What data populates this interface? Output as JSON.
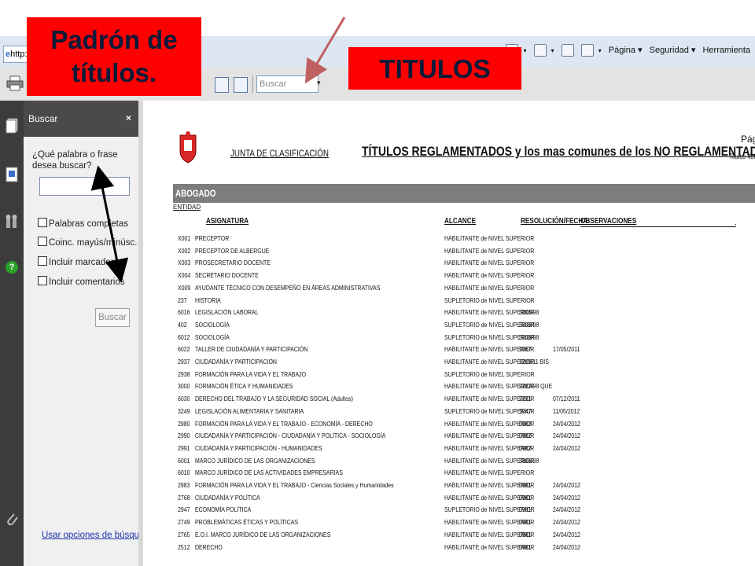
{
  "browser": {
    "url_fragment": "http:/",
    "toolbar_items": [
      "Página ▾",
      "Seguridad ▾",
      "Herramienta"
    ]
  },
  "pdf_toolbar": {
    "search_placeholder": "Buscar",
    "dropdown_glyph": "▾"
  },
  "search_panel": {
    "title": "Buscar",
    "close": "×",
    "question": "¿Qué palabra o frase desea buscar?",
    "options": [
      "Palabras completas",
      "Coinc. mayús/minúsc.",
      "Incluir marcadores",
      "Incluir comentarios"
    ],
    "button": "Buscar",
    "options_link": "Usar opciones de búsqueda"
  },
  "document": {
    "org": "JUNTA DE CLASIFICACIÓN",
    "title": "TÍTULOS REGLAMENTADOS y los mas comunes de los NO REGLAMENTADOS",
    "page_label": "Págir",
    "page_sub": "Titulos Ver",
    "section": "ABOGADO",
    "entity_label": "ENTIDAD",
    "columns": {
      "asignatura": "ASIGNATURA",
      "alcance": "ALCANCE",
      "resolucion": "RESOLUCIÓN/FECHA",
      "observaciones": "OBSERVACIONES",
      "dot": "."
    },
    "rows": [
      {
        "code": "X001",
        "asignatura": "PRECEPTOR",
        "alcance": "HABILITANTE de NIVEL SUPERIOR",
        "res": "",
        "fecha": ""
      },
      {
        "code": "X002",
        "asignatura": "PRECEPTOR DE ALBERGUE",
        "alcance": "HABILITANTE de NIVEL SUPERIOR",
        "res": "",
        "fecha": ""
      },
      {
        "code": "X003",
        "asignatura": "PROSECRETARIO DOCENTE",
        "alcance": "HABILITANTE de NIVEL SUPERIOR",
        "res": "",
        "fecha": ""
      },
      {
        "code": "X004",
        "asignatura": "SECRETARIO DOCENTE",
        "alcance": "HABILITANTE de NIVEL SUPERIOR",
        "res": "",
        "fecha": ""
      },
      {
        "code": "X009",
        "asignatura": "AYUDANTE TÉCNICO CON DESEMPEÑO EN ÁREAS ADMINISTRATIVAS",
        "alcance": "HABILITANTE de NIVEL SUPERIOR",
        "res": "",
        "fecha": ""
      },
      {
        "code": "237",
        "asignatura": "HISTORIA",
        "alcance": "SUPLETORIO de NIVEL SUPERIOR",
        "res": "",
        "fecha": ""
      },
      {
        "code": "6016",
        "asignatura": "LEGISLACIÓN LABORAL",
        "alcance": "HABILITANTE de NIVEL SUPERIOR",
        "res": "3806/98",
        "fecha": ""
      },
      {
        "code": "402",
        "asignatura": "SOCIOLOGÍA",
        "alcance": "SUPLETORIO de NIVEL SUPERIOR",
        "res": "3806/98",
        "fecha": ""
      },
      {
        "code": "6012",
        "asignatura": "SOCIOLOGÍA",
        "alcance": "SUPLETORIO de NIVEL SUPERIOR",
        "res": "3806/98",
        "fecha": ""
      },
      {
        "code": "6022",
        "asignatura": "TALLER DE CIUDADANÍA Y PARTICIPACIÓN",
        "alcance": "HABILITANTE de NIVEL SUPERIOR",
        "res": "1067",
        "fecha": "17/05/2011"
      },
      {
        "code": "2937",
        "asignatura": "CIUDADANÍA Y PARTICIPACIÓN",
        "alcance": "HABILITANTE de NIVEL SUPERIOR",
        "res": "1209/11 BIS",
        "fecha": ""
      },
      {
        "code": "2938",
        "asignatura": "FORMACIÓN PARA LA VIDA Y EL TRABAJO",
        "alcance": "SUPLETORIO de NIVEL SUPERIOR",
        "res": "",
        "fecha": ""
      },
      {
        "code": "3000",
        "asignatura": "FORMACIÓN ÉTICA Y HUMANIDADES",
        "alcance": "HABILITANTE de NIVEL SUPERIOR",
        "res": "2282/98 QUE",
        "fecha": ""
      },
      {
        "code": "6030",
        "asignatura": "DERECHO DEL TRABAJO Y LA SEGURIDAD SOCIAL (Adultos)",
        "alcance": "HABILITANTE de NIVEL SUPERIOR",
        "res": "2231",
        "fecha": "07/12/2011"
      },
      {
        "code": "3249",
        "asignatura": "LEGISLACIÓN ALIMENTARIA Y SANITARIA",
        "alcance": "SUPLETORIO de NIVEL SUPERIOR",
        "res": "1047",
        "fecha": "11/05/2012"
      },
      {
        "code": "2980",
        "asignatura": "FORMACIÓN PARA LA VIDA Y EL TRABAJO - ECONOMÍA - DERECHO",
        "alcance": "HABILITANTE de NIVEL SUPERIOR",
        "res": "0982",
        "fecha": "24/04/2012"
      },
      {
        "code": "2990",
        "asignatura": "CIUDADANÍA Y PARTICIPACIÓN - CIUDADANÍA Y POLÍTICA - SOCIOLOGÍA",
        "alcance": "HABILITANTE de NIVEL SUPERIOR",
        "res": "0982",
        "fecha": "24/04/2012"
      },
      {
        "code": "2991",
        "asignatura": "CIUDADANÍA Y PARTICIPACIÓN - HUMANIDADES",
        "alcance": "HABILITANTE de NIVEL SUPERIOR",
        "res": "0982",
        "fecha": "24/04/2012"
      },
      {
        "code": "6001",
        "asignatura": "MARCO JURÍDICO DE LAS ORGANIZACIONES",
        "alcance": "HABILITANTE de NIVEL SUPERIOR",
        "res": "3806/98",
        "fecha": ""
      },
      {
        "code": "6010",
        "asignatura": "MARCO JURÍDICO DE LAS ACTIVIDADES EMPRESARIAS",
        "alcance": "HABILITANTE de NIVEL SUPERIOR",
        "res": "",
        "fecha": ""
      },
      {
        "code": "2983",
        "asignatura": "FORMACIÓN PARA LA VIDA Y EL TRABAJO - Ciencias Sociales y Humanidades",
        "alcance": "HABILITANTE de NIVEL SUPERIOR",
        "res": "0981",
        "fecha": "24/04/2012"
      },
      {
        "code": "2768",
        "asignatura": "CIUDADANÍA Y POLÍTICA",
        "alcance": "HABILITANTE de NIVEL SUPERIOR",
        "res": "0981",
        "fecha": "24/04/2012"
      },
      {
        "code": "2947",
        "asignatura": "ECONOMÍA POLÍTICA",
        "alcance": "SUPLETORIO de NIVEL SUPERIOR",
        "res": "0981",
        "fecha": "24/04/2012"
      },
      {
        "code": "2749",
        "asignatura": "PROBLEMÁTICAS ÉTICAS Y POLÍTICAS",
        "alcance": "HABILITANTE de NIVEL SUPERIOR",
        "res": "0981",
        "fecha": "24/04/2012"
      },
      {
        "code": "2765",
        "asignatura": "E.O.I. MARCO JURÍDICO DE LAS ORGANIZACIONES",
        "alcance": "HABILITANTE de NIVEL SUPERIOR",
        "res": "0981",
        "fecha": "24/04/2012"
      },
      {
        "code": "2512",
        "asignatura": "DERECHO",
        "alcance": "HABILITANTE de NIVEL SUPERIOR",
        "res": "0981",
        "fecha": "24/04/2012"
      }
    ]
  },
  "annotations": {
    "padron": "Padrón de títulos.",
    "titulos": "TITULOS"
  },
  "colors": {
    "annotation_bg": "#ff0000",
    "annotation_text": "#061a3a",
    "arrow": "#c06060",
    "double_arrow": "#000000"
  }
}
